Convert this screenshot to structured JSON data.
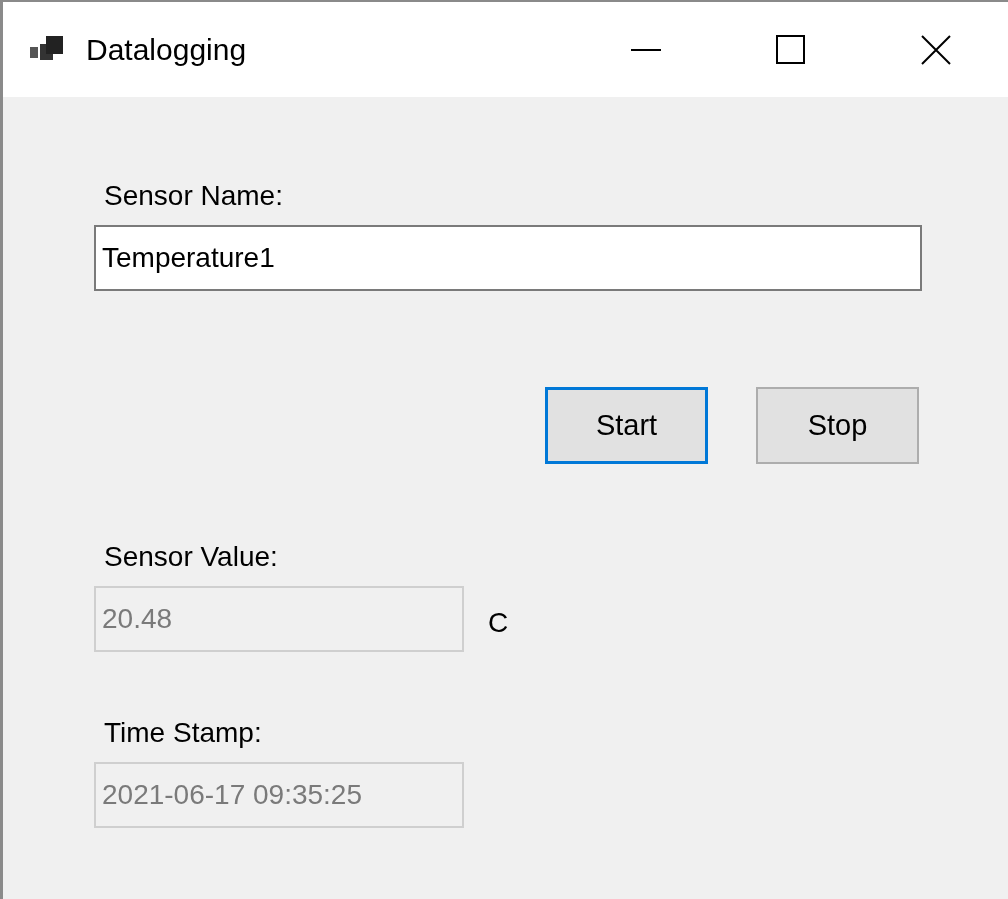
{
  "window": {
    "title": "Datalogging"
  },
  "sensor_name": {
    "label": "Sensor Name:",
    "value": "Temperature1",
    "disabled": false
  },
  "buttons": [
    {
      "label": "Start",
      "focused": true
    },
    {
      "label": "Stop",
      "focused": false
    }
  ],
  "sensor_value": {
    "label": "Sensor Value:",
    "value": "20.48",
    "disabled": true,
    "unit": "C"
  },
  "time_stamp": {
    "label": "Time Stamp:",
    "value": "2021-06-17 09:35:25",
    "disabled": true
  }
}
